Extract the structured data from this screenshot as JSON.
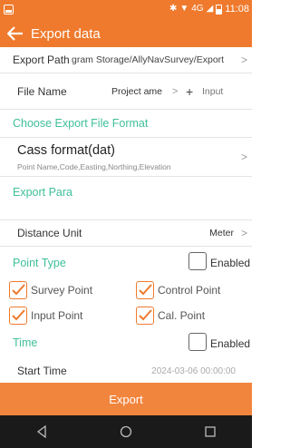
{
  "status_bar": {
    "time": "11:08",
    "network": "4G"
  },
  "app_bar": {
    "title": "Export data"
  },
  "export_path": {
    "label": "Export Path",
    "value": "gram Storage/AllyNavSurvey/Export"
  },
  "file_name": {
    "label": "File Name",
    "value": "Project ame",
    "plus": "+",
    "placeholder": "Input"
  },
  "format_section": {
    "title": "Choose Export File Format"
  },
  "format": {
    "name": "Cass format(dat)",
    "fields": "Point Name,Code,Easting,Northing,Elevation"
  },
  "export_para": {
    "title": "Export Para"
  },
  "distance_unit": {
    "label": "Distance Unit",
    "value": "Meter"
  },
  "point_type": {
    "title": "Point Type",
    "enabled_label": "Enabled"
  },
  "point_options": [
    {
      "label": "Survey Point",
      "checked": true
    },
    {
      "label": "Control Point",
      "checked": true
    },
    {
      "label": "Input Point",
      "checked": true
    },
    {
      "label": "Cal. Point",
      "checked": true
    }
  ],
  "time_section": {
    "title": "Time",
    "enabled_label": "Enabled"
  },
  "start_time": {
    "label": "Start Time",
    "value": "2024-03-06 00:00:00"
  },
  "export_button": {
    "label": "Export"
  },
  "colors": {
    "accent": "#ef7a2d",
    "section_text": "#3fbf9a",
    "nav_bar": "#1a1a1a"
  }
}
